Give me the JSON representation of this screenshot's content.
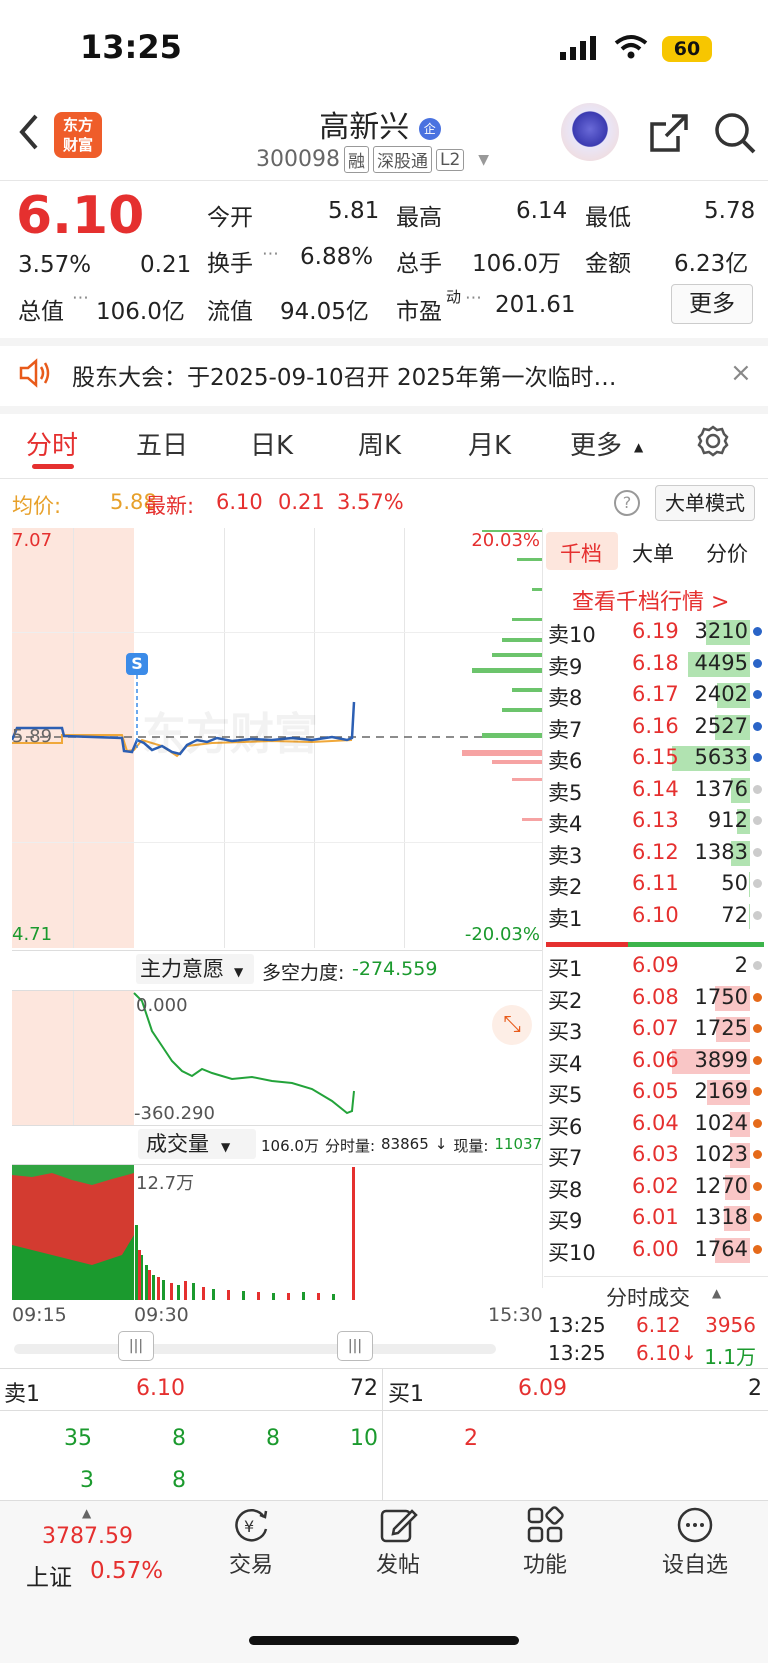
{
  "status_bar": {
    "time": "13:25",
    "battery": "60"
  },
  "header": {
    "back_icon": "chevron-left-icon",
    "app_logo_line1": "东方",
    "app_logo_line2": "财富",
    "stock_name": "高新兴",
    "name_badge": "企",
    "code": "300098",
    "tags": [
      "融",
      "深股通",
      "L2"
    ]
  },
  "quote": {
    "price": "6.10",
    "change_pct": "3.57%",
    "change": "0.21",
    "open_label": "今开",
    "open": "5.81",
    "high_label": "最高",
    "high": "6.14",
    "low_label": "最低",
    "low": "5.78",
    "turnover_label": "换手",
    "turnover": "6.88%",
    "volume_label": "总手",
    "volume": "106.0万",
    "amount_label": "金额",
    "amount": "6.23亿",
    "mktcap_label": "总值",
    "mktcap": "106.0亿",
    "float_label": "流值",
    "float": "94.05亿",
    "pe_label": "市盈",
    "pe_sup": "动",
    "pe": "201.61",
    "more_label": "更多"
  },
  "notice": {
    "text": "股东大会：于2025-09-10召开 2025年第一次临时…"
  },
  "tabs": [
    "分时",
    "五日",
    "日K",
    "周K",
    "月K",
    "更多"
  ],
  "priceline": {
    "avg_label": "均价:",
    "avg": "5.88",
    "last_label": "最新:",
    "last": "6.10",
    "chg": "0.21",
    "pct": "3.57%",
    "mode_label": "大单模式"
  },
  "chart": {
    "y_top": "7.07",
    "y_mid": "5.89",
    "y_bottom": "4.71",
    "pct_top": "20.03%",
    "pct_bottom": "-20.03%",
    "marker": "S",
    "watermark": "东方财富",
    "indicator_label": "主力意愿",
    "indicator_text_label": "多空力度:",
    "indicator_value": "-274.559",
    "ind_top": "0.000",
    "ind_bottom": "-360.290",
    "volume_label": "成交量",
    "vol_total": "106.0万",
    "vol_fs_label": "分时量:",
    "vol_fs": "83865",
    "vol_now_label": "现量:",
    "vol_now": "11037",
    "vol_max": "12.7万",
    "time_start": "09:15",
    "time_mid": "09:30",
    "time_end": "15:30"
  },
  "chart_data": {
    "type": "line",
    "x": [
      "09:15",
      "09:30",
      "15:30"
    ],
    "series": [],
    "ylim": [
      4.71,
      7.07
    ]
  },
  "orderbook": {
    "tabs": [
      "千档",
      "大单",
      "分价"
    ],
    "link": "查看千档行情 >",
    "asks": [
      {
        "label": "卖10",
        "price": "6.19",
        "vol": "3210"
      },
      {
        "label": "卖9",
        "price": "6.18",
        "vol": "4495"
      },
      {
        "label": "卖8",
        "price": "6.17",
        "vol": "2402"
      },
      {
        "label": "卖7",
        "price": "6.16",
        "vol": "2527"
      },
      {
        "label": "卖6",
        "price": "6.15",
        "vol": "5633"
      },
      {
        "label": "卖5",
        "price": "6.14",
        "vol": "1376"
      },
      {
        "label": "卖4",
        "price": "6.13",
        "vol": "912"
      },
      {
        "label": "卖3",
        "price": "6.12",
        "vol": "1383"
      },
      {
        "label": "卖2",
        "price": "6.11",
        "vol": "50"
      },
      {
        "label": "卖1",
        "price": "6.10",
        "vol": "72"
      }
    ],
    "bids": [
      {
        "label": "买1",
        "price": "6.09",
        "vol": "2"
      },
      {
        "label": "买2",
        "price": "6.08",
        "vol": "1750"
      },
      {
        "label": "买3",
        "price": "6.07",
        "vol": "1725"
      },
      {
        "label": "买4",
        "price": "6.06",
        "vol": "3899"
      },
      {
        "label": "买5",
        "price": "6.05",
        "vol": "2169"
      },
      {
        "label": "买6",
        "price": "6.04",
        "vol": "1024"
      },
      {
        "label": "买7",
        "price": "6.03",
        "vol": "1023"
      },
      {
        "label": "买8",
        "price": "6.02",
        "vol": "1270"
      },
      {
        "label": "买9",
        "price": "6.01",
        "vol": "1318"
      },
      {
        "label": "买10",
        "price": "6.00",
        "vol": "1764"
      }
    ],
    "ticks_label": "分时成交",
    "ticks": [
      {
        "time": "13:25",
        "price": "6.12",
        "vol": "3956"
      },
      {
        "time": "13:25",
        "price": "6.10↓",
        "vol": "1.1万"
      }
    ]
  },
  "bottom_table": {
    "sell_label": "卖1",
    "sell_price": "6.10",
    "sell_vol": "72",
    "buy_label": "买1",
    "buy_price": "6.09",
    "buy_vol": "2",
    "sell_orders_row1": [
      "35",
      "8",
      "8",
      "10"
    ],
    "sell_orders_row2": [
      "3",
      "8"
    ],
    "buy_orders_row1": [
      "2"
    ]
  },
  "bottom_nav": {
    "index_value": "3787.59",
    "index_name": "上证",
    "index_pct": "0.57%",
    "items": [
      {
        "label": "交易",
        "icon": "trade-yen-icon"
      },
      {
        "label": "发帖",
        "icon": "edit-icon"
      },
      {
        "label": "功能",
        "icon": "grid-icon"
      },
      {
        "label": "设自选",
        "icon": "more-dots-icon"
      }
    ]
  }
}
